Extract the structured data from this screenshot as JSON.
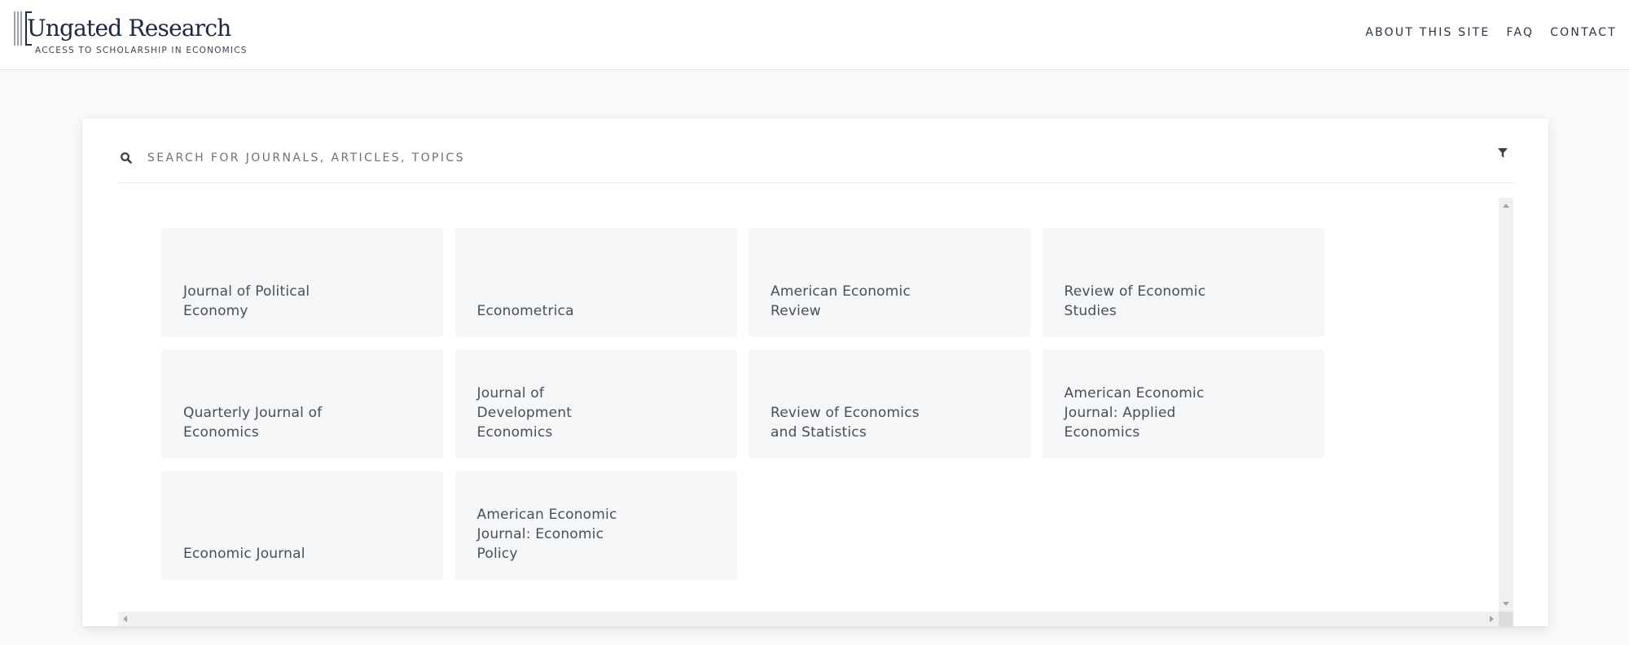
{
  "header": {
    "logo_title": "Ungated Research",
    "logo_subtitle": "ACCESS TO SCHOLARSHIP IN ECONOMICS",
    "nav": [
      {
        "label": "ABOUT THIS SITE"
      },
      {
        "label": "FAQ"
      },
      {
        "label": "CONTACT"
      }
    ]
  },
  "search": {
    "icon": "search-icon",
    "placeholder": "SEARCH FOR JOURNALS, ARTICLES, TOPICS",
    "value": "",
    "filter_icon": "filter-icon"
  },
  "journals": [
    {
      "title": "Journal of Political Economy"
    },
    {
      "title": "Econometrica"
    },
    {
      "title": "American Economic Review"
    },
    {
      "title": "Review of Economic Studies"
    },
    {
      "title": "Quarterly Journal of Economics"
    },
    {
      "title": "Journal of Development Economics"
    },
    {
      "title": "Review of Economics and Statistics"
    },
    {
      "title": "American Economic Journal: Applied Economics"
    },
    {
      "title": "Economic Journal"
    },
    {
      "title": "American Economic Journal: Economic Policy"
    }
  ],
  "colors": {
    "page_background": "#f8f9fb",
    "card_background": "#f4f6f8",
    "text_primary": "#2b3440",
    "logo_navy": "#1c2740"
  }
}
